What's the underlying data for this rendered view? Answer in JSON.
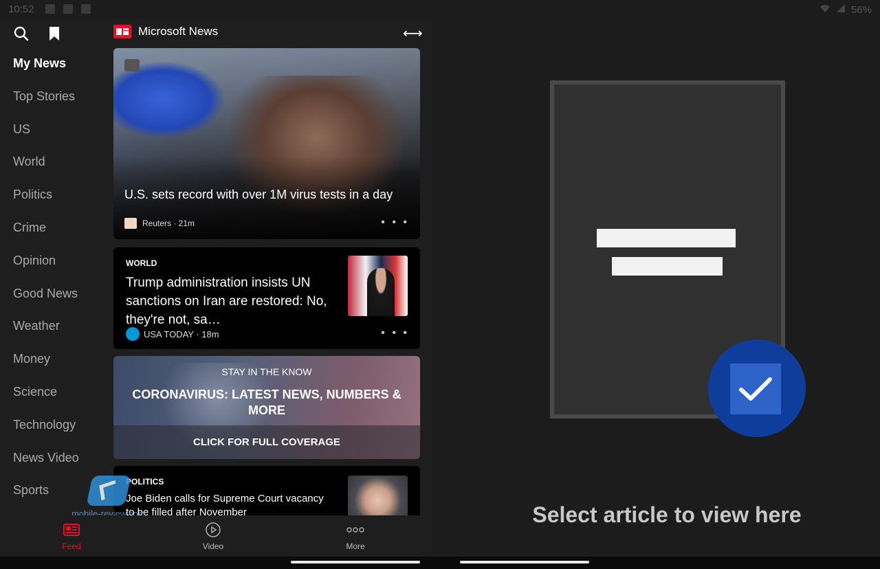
{
  "status_bar": {
    "time": "10:52",
    "battery": "56%"
  },
  "app": {
    "name": "Microsoft News"
  },
  "nav": {
    "items": [
      {
        "label": "My News",
        "active": true
      },
      {
        "label": "Top Stories",
        "active": false
      },
      {
        "label": "US",
        "active": false
      },
      {
        "label": "World",
        "active": false
      },
      {
        "label": "Politics",
        "active": false
      },
      {
        "label": "Crime",
        "active": false
      },
      {
        "label": "Opinion",
        "active": false
      },
      {
        "label": "Good News",
        "active": false
      },
      {
        "label": "Weather",
        "active": false
      },
      {
        "label": "Money",
        "active": false
      },
      {
        "label": "Science",
        "active": false
      },
      {
        "label": "Technology",
        "active": false
      },
      {
        "label": "News Video",
        "active": false
      },
      {
        "label": "Sports",
        "active": false
      }
    ]
  },
  "feed": {
    "hero": {
      "title": "U.S. sets record with over 1M virus tests in a day",
      "source": "Reuters · 21m"
    },
    "world": {
      "category": "WORLD",
      "title": "Trump administration insists UN sanctions on Iran are restored: No, they're not, sa…",
      "source": "USA TODAY · 18m"
    },
    "coverage": {
      "kicker": "STAY IN THE KNOW",
      "headline": "CORONAVIRUS: LATEST NEWS, NUMBERS & MORE",
      "cta": "CLICK FOR FULL COVERAGE"
    },
    "politics": {
      "category": "POLITICS",
      "title": "Joe Biden calls for Supreme Court vacancy to be filled after November"
    },
    "more_dots": "• • •"
  },
  "watermark": {
    "text": "mobile-review.com"
  },
  "tabbar": {
    "feed": "Feed",
    "video": "Video",
    "more": "More"
  },
  "reader": {
    "prompt": "Select article to view here"
  },
  "colors": {
    "accent": "#e81123",
    "check_circle": "#0f3d9c",
    "check_box": "#2e63c7"
  }
}
